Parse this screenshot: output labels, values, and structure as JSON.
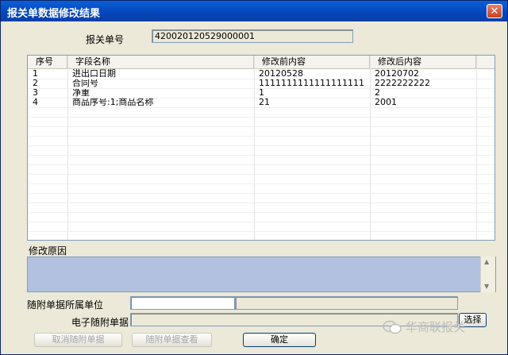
{
  "window": {
    "title": "报关单数据修改结果",
    "close_glyph": "✕"
  },
  "header": {
    "decl_no_label": "报关单号",
    "decl_no_value": "420020120529000001"
  },
  "table": {
    "columns": [
      "序号",
      "字段名称",
      "修改前内容",
      "修改后内容"
    ],
    "rows": [
      [
        "1",
        "进出口日期",
        "20120528",
        "20120702"
      ],
      [
        "2",
        "合同号",
        "1111111111111111111",
        "2222222222"
      ],
      [
        "3",
        "净重",
        "1",
        "2"
      ],
      [
        "4",
        "商品序号:1;商品名称",
        "21",
        "2001"
      ]
    ]
  },
  "reason": {
    "label": "修改原因",
    "value": ""
  },
  "attachment": {
    "unit_label": "随附单据所属单位",
    "unit_code": "",
    "unit_name": "",
    "edoc_label": "电子随附单据",
    "edoc_value": "",
    "select_button": "选择"
  },
  "buttons": {
    "cancel_attach": "取消随附单据",
    "view_attach": "随附单据查看",
    "ok": "确定"
  },
  "watermark": {
    "text": "华商联报关",
    "icon": "wechat-icon"
  },
  "colors": {
    "title_bar": "#0a4fc8",
    "reason_box": "#b3c1e1",
    "dialog_bg": "#ece9d8"
  }
}
